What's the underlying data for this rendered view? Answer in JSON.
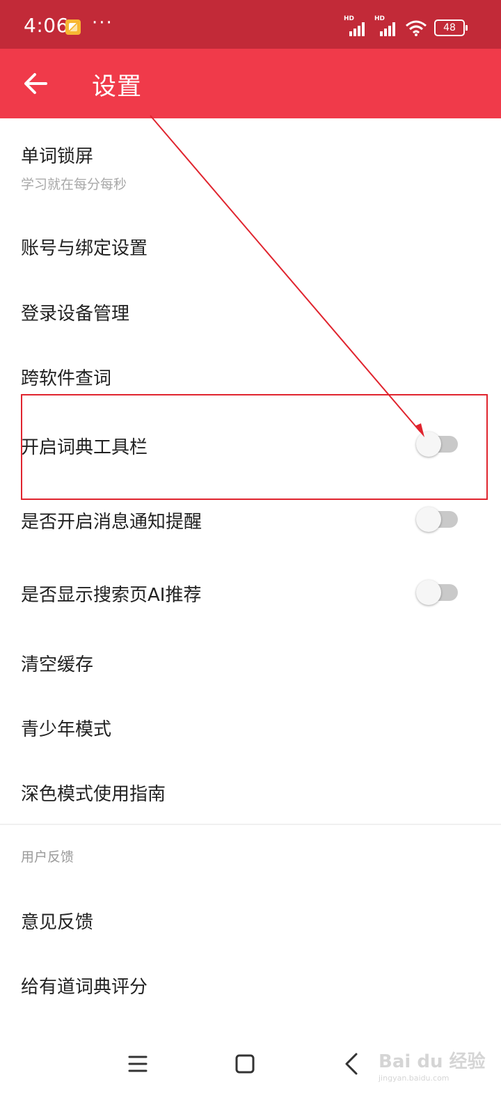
{
  "status_bar": {
    "time": "4:06",
    "dots": "···",
    "battery": "48"
  },
  "header": {
    "title": "设置"
  },
  "settings": {
    "items": [
      {
        "label": "单词锁屏",
        "sub": "学习就在每分每秒"
      },
      {
        "label": "账号与绑定设置"
      },
      {
        "label": "登录设备管理"
      },
      {
        "label": "跨软件查词"
      },
      {
        "label": "开启词典工具栏",
        "toggle": "off"
      },
      {
        "label": "是否开启消息通知提醒",
        "toggle": "off"
      },
      {
        "label": "是否显示搜索页AI推荐",
        "toggle": "off"
      },
      {
        "label": "清空缓存"
      },
      {
        "label": "青少年模式"
      },
      {
        "label": "深色模式使用指南"
      }
    ]
  },
  "feedback": {
    "section_title": "用户反馈",
    "items": [
      {
        "label": "意见反馈"
      },
      {
        "label": "给有道词典评分"
      }
    ]
  },
  "watermark": {
    "logo_text": "Bai du 经验",
    "url": "jingyan.baidu.com"
  },
  "colors": {
    "status_bar": "#c22a38",
    "app_bar": "#f03a4a",
    "annotation": "#e0242e"
  }
}
